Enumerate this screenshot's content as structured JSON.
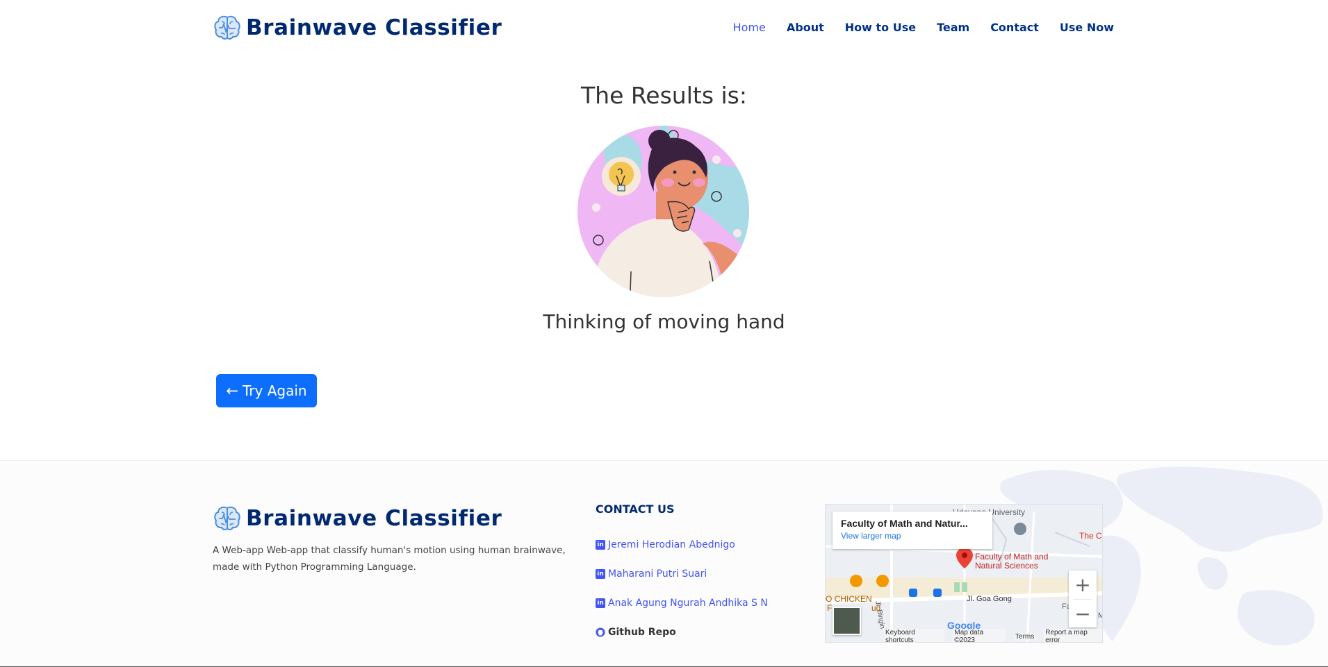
{
  "header": {
    "brand": "Brainwave Classifier",
    "nav": [
      {
        "label": "Home",
        "active": true
      },
      {
        "label": "About"
      },
      {
        "label": "How to Use"
      },
      {
        "label": "Team"
      },
      {
        "label": "Contact"
      },
      {
        "label": "Use Now"
      }
    ]
  },
  "main": {
    "title": "The Results is:",
    "result": "Thinking of moving hand",
    "try_again": "Try Again"
  },
  "footer": {
    "brand": "Brainwave Classifier",
    "description": "A Web-app Web-app that classify human's motion using human brainwave, made with Python Programming Language.",
    "contact_title": "CONTACT US",
    "contacts": [
      {
        "label": "Jeremi Herodian Abednigo",
        "icon": "linkedin-icon"
      },
      {
        "label": "Maharani Putri Suari",
        "icon": "linkedin-icon"
      },
      {
        "label": "Anak Agung Ngurah Andhika S N",
        "icon": "linkedin-icon"
      }
    ],
    "github": {
      "label": "Github Repo",
      "icon": "github-icon"
    }
  },
  "map": {
    "place_title": "Faculty of Math and Natur...",
    "view_larger": "View larger map",
    "pin_label_1": "Faculty of Math and",
    "pin_label_2": "Natural Sciences",
    "road": "Jl. Goa Gong",
    "road_vertical": "Jl. Bingin",
    "university": "Udayana University",
    "chicken": "O CHICKEN",
    "chicken_2": "F",
    "chicken_3": "ud",
    "red_text": "The C",
    "right_text_1": "Fa",
    "right_text_2": "M",
    "zoom_in": "+",
    "zoom_out": "−",
    "google": "Google",
    "footer_links": [
      "Keyboard shortcuts",
      "Map data ©2023",
      "Terms",
      "Report a map error"
    ]
  },
  "colors": {
    "brand": "#012970",
    "nav_active": "#4154f1",
    "button": "#0d6efd",
    "link": "#4154f1"
  }
}
